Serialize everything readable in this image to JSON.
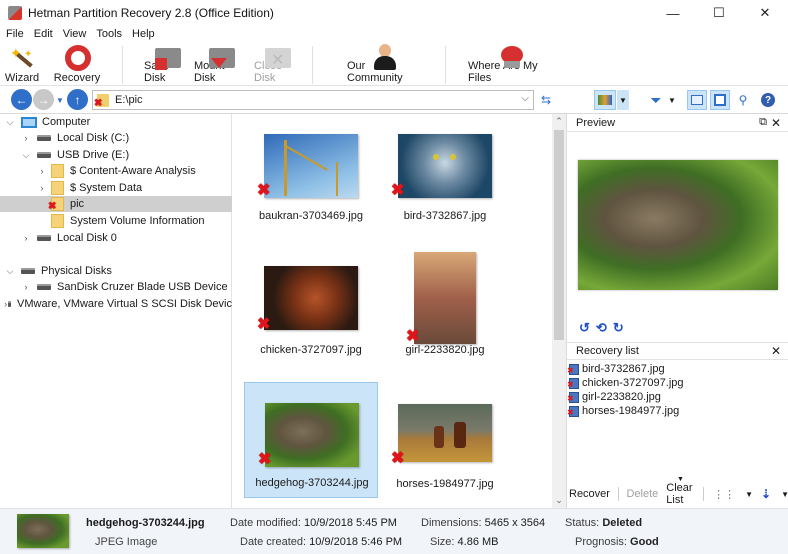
{
  "window": {
    "title": "Hetman Partition Recovery 2.8 (Office Edition)",
    "minimize": "—",
    "maximize": "☐",
    "close": "✕"
  },
  "menu": [
    "File",
    "Edit",
    "View",
    "Tools",
    "Help"
  ],
  "toolbar": {
    "wizard": "Wizard",
    "recovery": "Recovery",
    "save_disk": "Save Disk",
    "mount_disk": "Mount Disk",
    "close_disk": "Close Disk",
    "community": "Our Community",
    "where_files": "Where Are My Files"
  },
  "nav": {
    "address": "E:\\pic",
    "back_icon": "arrow-left",
    "forward_icon": "arrow-right",
    "up_icon": "arrow-up"
  },
  "tree": [
    {
      "label": "Computer",
      "level": 0,
      "expanded": true,
      "icon": "computer"
    },
    {
      "label": "Local Disk (C:)",
      "level": 1,
      "expanded": false,
      "icon": "drive"
    },
    {
      "label": "USB Drive (E:)",
      "level": 1,
      "expanded": true,
      "icon": "drive"
    },
    {
      "label": "$ Content-Aware Analysis",
      "level": 2,
      "expanded": false,
      "icon": "folder"
    },
    {
      "label": "$ System Data",
      "level": 2,
      "expanded": false,
      "icon": "folder"
    },
    {
      "label": "pic",
      "level": 2,
      "selected": true,
      "icon": "folder-deleted"
    },
    {
      "label": "System Volume Information",
      "level": 2,
      "icon": "folder"
    },
    {
      "label": "Local Disk 0",
      "level": 1,
      "expanded": false,
      "icon": "drive"
    },
    {
      "label": "Physical Disks",
      "level": 0,
      "expanded": true,
      "icon": "drive"
    },
    {
      "label": "SanDisk Cruzer Blade USB Device",
      "level": 1,
      "expanded": false,
      "icon": "drive"
    },
    {
      "label": "VMware, VMware Virtual S SCSI Disk Devic",
      "level": 1,
      "expanded": false,
      "icon": "drive"
    }
  ],
  "files": [
    {
      "name": "baukran-3703469.jpg",
      "deleted": true
    },
    {
      "name": "bird-3732867.jpg",
      "deleted": true
    },
    {
      "name": "chicken-3727097.jpg",
      "deleted": true
    },
    {
      "name": "girl-2233820.jpg",
      "deleted": true
    },
    {
      "name": "hedgehog-3703244.jpg",
      "deleted": true,
      "selected": true
    },
    {
      "name": "horses-1984977.jpg",
      "deleted": true
    }
  ],
  "preview": {
    "title": "Preview"
  },
  "recovery_list": {
    "title": "Recovery list",
    "items": [
      "bird-3732867.jpg",
      "chicken-3727097.jpg",
      "girl-2233820.jpg",
      "horses-1984977.jpg"
    ],
    "recover": "Recover",
    "delete": "Delete",
    "clear": "Clear List"
  },
  "status": {
    "filename": "hedgehog-3703244.jpg",
    "type": "JPEG Image",
    "date_modified_label": "Date modified:",
    "date_modified": "10/9/2018 5:45 PM",
    "date_created_label": "Date created:",
    "date_created": "10/9/2018 5:46 PM",
    "dimensions_label": "Dimensions:",
    "dimensions": "5465 x 3564",
    "size_label": "Size:",
    "size": "4.86 MB",
    "status_label": "Status:",
    "status": "Deleted",
    "prognosis_label": "Prognosis:",
    "prognosis": "Good"
  }
}
